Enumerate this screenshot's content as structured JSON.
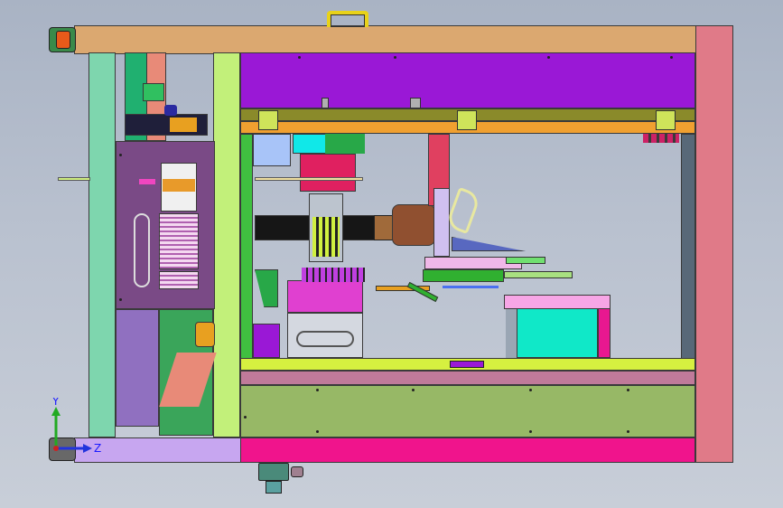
{
  "viewport": {
    "background_top": "#a9b3c4",
    "background_bottom": "#c8ced8"
  },
  "triad": {
    "y_label": "Y",
    "z_label": "Z",
    "colors": {
      "y_axis": "#22aa22",
      "z_axis": "#2233dd",
      "origin": "#cc2222"
    }
  },
  "palette": {
    "top_beam": "#dba870",
    "right_post": "#e07a88",
    "upper_panel": "#9a18d6",
    "bottom_beam": "#f0148c",
    "bottom_left_beam": "#c7a6f0",
    "left_post_green": "#7ed6ae",
    "lower_panel": "#97b866",
    "bed_plate": "#d6f040",
    "rail_olive": "#8a8a2a",
    "rail_orange": "#f0a030",
    "cyan_box": "#10e8c8",
    "pink_cover": "#f7a6e6"
  },
  "icons": [
    "coordinate-triad-icon",
    "carry-handle-icon",
    "hinge-icon",
    "leveling-foot-icon",
    "motor-icon"
  ]
}
